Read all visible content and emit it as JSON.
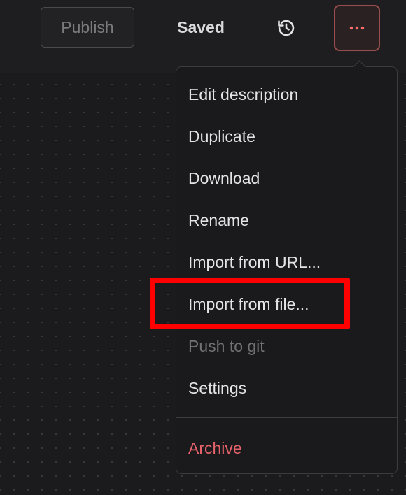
{
  "toolbar": {
    "publish_label": "Publish",
    "saved_label": "Saved",
    "history_icon": "history-icon",
    "more_icon": "more-horizontal-icon"
  },
  "menu": {
    "items": [
      {
        "label": "Edit description",
        "state": "enabled"
      },
      {
        "label": "Duplicate",
        "state": "enabled"
      },
      {
        "label": "Download",
        "state": "enabled"
      },
      {
        "label": "Rename",
        "state": "enabled"
      },
      {
        "label": "Import from URL...",
        "state": "enabled"
      },
      {
        "label": "Import from file...",
        "state": "enabled",
        "highlighted": true
      },
      {
        "label": "Push to git",
        "state": "disabled"
      },
      {
        "label": "Settings",
        "state": "enabled"
      }
    ],
    "danger_item": {
      "label": "Archive",
      "state": "danger"
    }
  },
  "colors": {
    "background": "#1b1b1d",
    "menu_background": "#1a1a1c",
    "accent": "#e5626a",
    "highlight": "#ff0000"
  }
}
